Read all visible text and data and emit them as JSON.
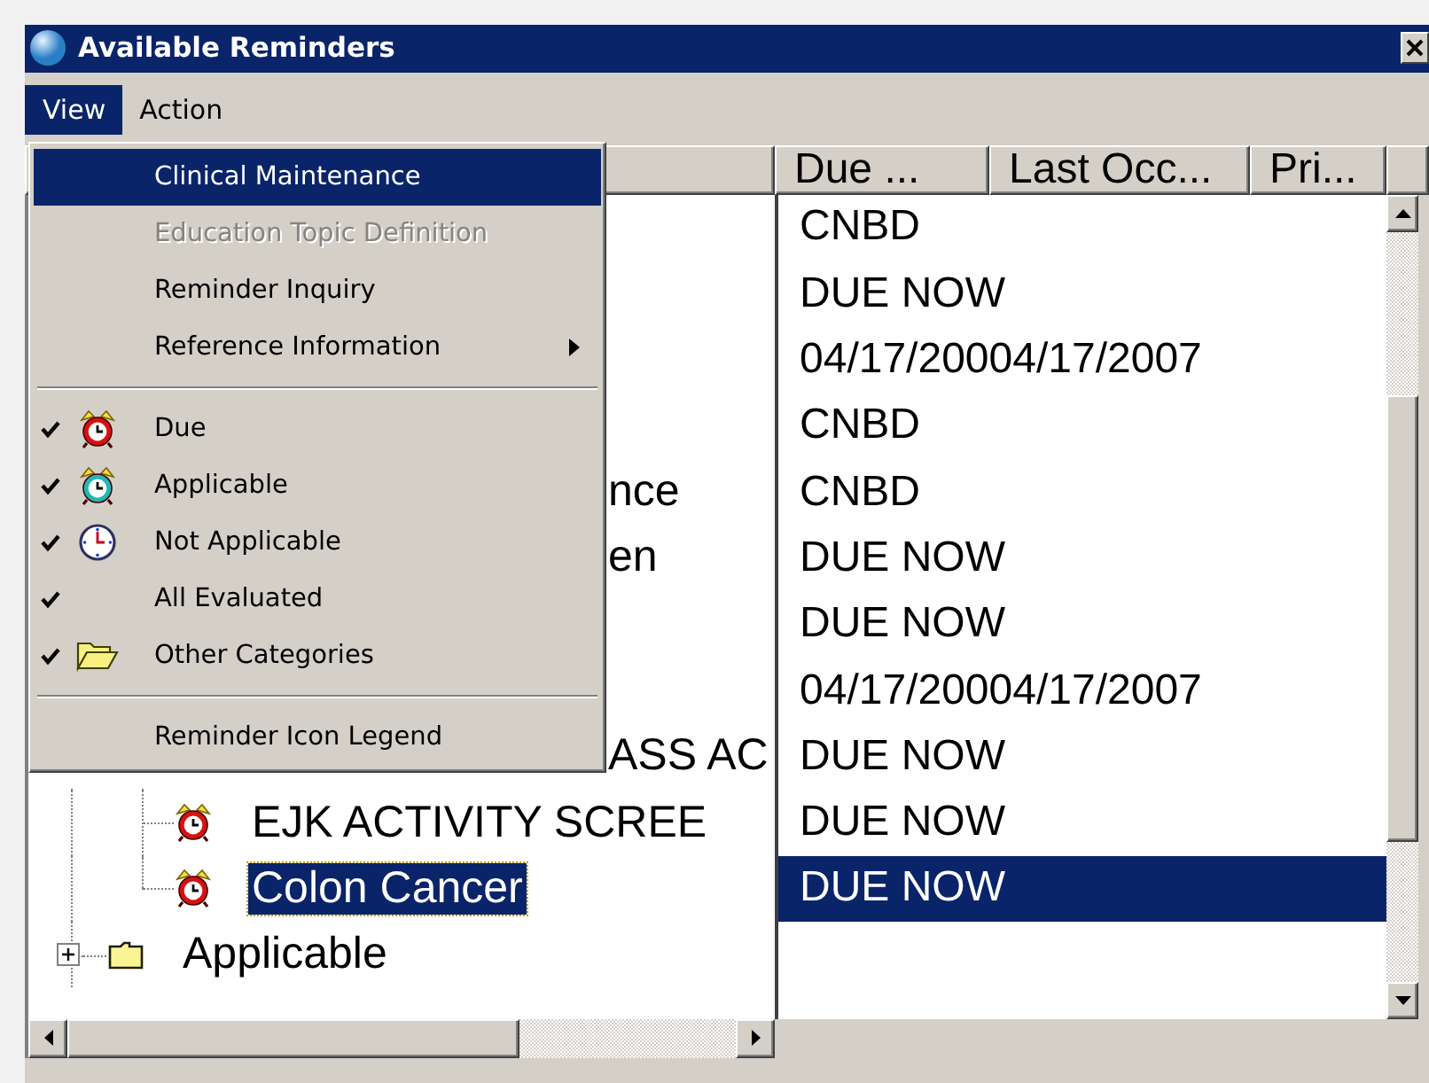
{
  "window": {
    "title": "Available Reminders"
  },
  "menubar": [
    {
      "label": "View",
      "selected": true
    },
    {
      "label": "Action",
      "selected": false
    }
  ],
  "menu": {
    "items": [
      {
        "kind": "item",
        "label": "Clinical Maintenance",
        "selected": true,
        "disabled": false
      },
      {
        "kind": "item",
        "label": "Education Topic Definition",
        "selected": false,
        "disabled": true
      },
      {
        "kind": "item",
        "label": "Reminder Inquiry",
        "selected": false,
        "disabled": false
      },
      {
        "kind": "item",
        "label": "Reference Information",
        "selected": false,
        "disabled": false,
        "submenu": true
      },
      {
        "kind": "separator"
      },
      {
        "kind": "check",
        "label": "Due",
        "checked": true,
        "selected": false,
        "disabled": false
      },
      {
        "kind": "check",
        "label": "Applicable",
        "checked": true,
        "selected": false,
        "disabled": false
      },
      {
        "kind": "check",
        "label": "Not Applicable",
        "checked": true,
        "selected": false,
        "disabled": false
      },
      {
        "kind": "check",
        "label": "All Evaluated",
        "checked": true,
        "selected": false,
        "disabled": false
      },
      {
        "kind": "check",
        "label": "Other Categories",
        "checked": true,
        "selected": false,
        "disabled": false
      },
      {
        "kind": "separator"
      },
      {
        "kind": "item",
        "label": "Reminder Icon Legend",
        "selected": false,
        "disabled": false
      }
    ]
  },
  "columns": [
    "Due ...",
    "Last Occ...",
    "Pri..."
  ],
  "rows": [
    {
      "kind": "covered",
      "due": "CNBD",
      "selected": false
    },
    {
      "kind": "covered",
      "due": "DUE NOW",
      "selected": false
    },
    {
      "kind": "covered",
      "due": "04/17/20004/17/2007",
      "selected": false
    },
    {
      "kind": "covered",
      "due": "CNBD",
      "selected": false
    },
    {
      "kind": "fragment",
      "name": "nce",
      "due": "CNBD",
      "selected": false
    },
    {
      "kind": "fragment",
      "name": "en",
      "due": "DUE NOW",
      "selected": false
    },
    {
      "kind": "covered",
      "due": "DUE NOW",
      "selected": false
    },
    {
      "kind": "covered",
      "due": "04/17/20004/17/2007",
      "selected": false
    },
    {
      "kind": "fragment",
      "name": "ASS AC",
      "due": "DUE NOW",
      "selected": false
    },
    {
      "kind": "reminder",
      "name": "EJK ACTIVITY SCREE",
      "due": "DUE NOW",
      "selected": false
    },
    {
      "kind": "reminder",
      "name": "Colon Cancer",
      "due": "DUE NOW",
      "selected": true
    },
    {
      "kind": "folder",
      "name": "Applicable",
      "expanded": false,
      "selected": false
    }
  ]
}
